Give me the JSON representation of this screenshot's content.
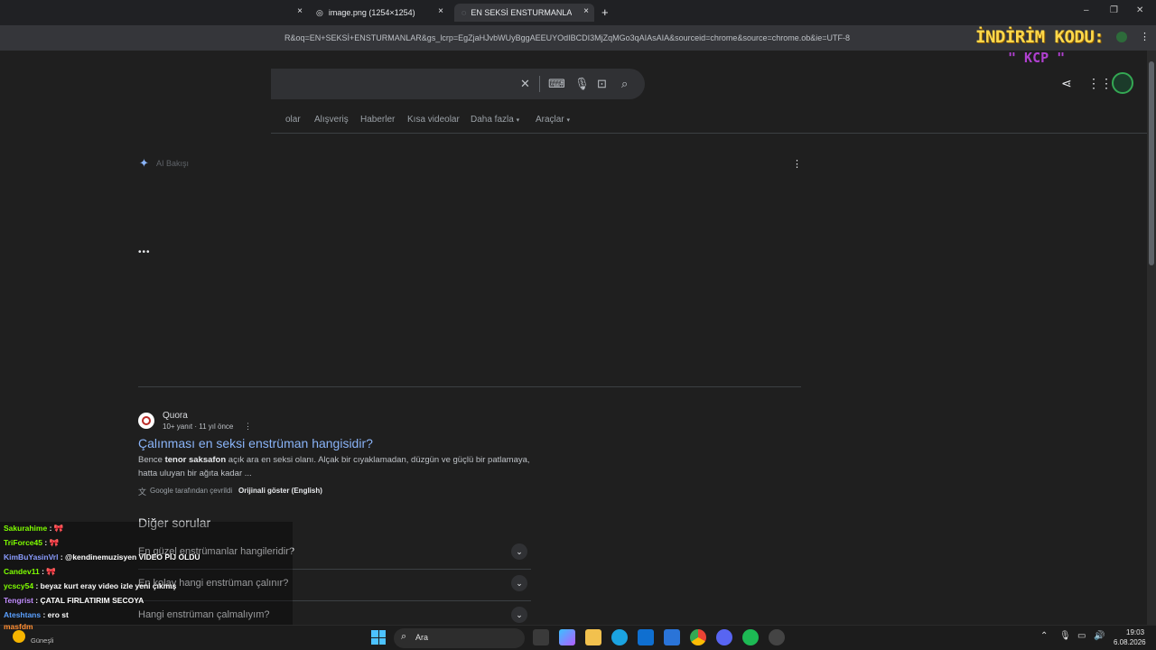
{
  "browser": {
    "tabs": [
      {
        "label": ""
      },
      {
        "label": "image.png (1254×1254)"
      },
      {
        "label": "EN SEKSİ ENSTURMANLAR - G"
      }
    ],
    "new_tab": "+",
    "close_glyph": "×",
    "url": "R&oq=EN+SEKSİ+ENSTURMANLAR&gs_lcrp=EgZjaHJvbWUyBggAEEUYOdIBCDI3MjZqMGo3qAIAsAIA&sourceid=chrome&source=chrome.ob&ie=UTF-8",
    "window_controls": [
      "–",
      "❐",
      "✕"
    ]
  },
  "search": {
    "nav_tabs": [
      "olar",
      "Alışveriş",
      "Haberler",
      "Kısa videolar",
      "Daha fazla",
      "Araçlar"
    ],
    "ai_label": "AI Bakışı",
    "loading": "•••"
  },
  "result": {
    "source": "Quora",
    "meta": "10+ yanıt · 11 yıl önce",
    "title": "Çalınması en seksi enstrüman hangisidir?",
    "snippet_pre": "Bence ",
    "snippet_bold": "tenor saksafon",
    "snippet_post": " açık ara en seksi olanı. Alçak bir cıyaklamadan, düzgün ve güçlü bir patlamaya, hatta uluyan bir ağıta kadar ...",
    "translated_note": "Google tarafından çevrildi",
    "show_original": "Orijinali göster (English)"
  },
  "other_questions": {
    "heading": "Diğer sorular",
    "items": [
      "En güzel enstrümanlar hangileridir?",
      "En kolay hangi enstrüman çalınır?",
      "Hangi enstrüman çalmalıyım?"
    ]
  },
  "promo": {
    "line1": "İNDİRİM KODU:",
    "line2": "\" KCP \""
  },
  "chat": [
    {
      "user": "Sakurahime",
      "msg": "🎀",
      "color": "#7fff00"
    },
    {
      "user": "TriForce45",
      "msg": "🎀",
      "color": "#7fff00"
    },
    {
      "user": "KimBuYasinVrl",
      "msg": "@kendinemuzisyen VİDEO PİJ OLDU",
      "color": "#8a9cff"
    },
    {
      "user": "Candev11",
      "msg": "🎀",
      "color": "#7fff00"
    },
    {
      "user": "ycscy54",
      "msg": "beyaz kurt eray video izle yeni çıkmış",
      "color": "#7fff00"
    },
    {
      "user": "Tengrist",
      "msg": "ÇATAL FIRLATIRIM SECOYA",
      "color": "#c18cff"
    },
    {
      "user": "Ateshtans",
      "msg": "ero st",
      "color": "#5aa0ff"
    },
    {
      "user": "masfdm",
      "msg": "",
      "color": "#ff8c30"
    }
  ],
  "weather": {
    "label": "Güneşli"
  },
  "taskbar": {
    "search_placeholder": "Ara",
    "time": "19:03",
    "date": "6.08.2026"
  },
  "colors": {
    "link": "#8ab4f8",
    "bg": "#1f1f1f",
    "promo_yellow": "#ffd84a",
    "promo_purple": "#b040d0"
  }
}
